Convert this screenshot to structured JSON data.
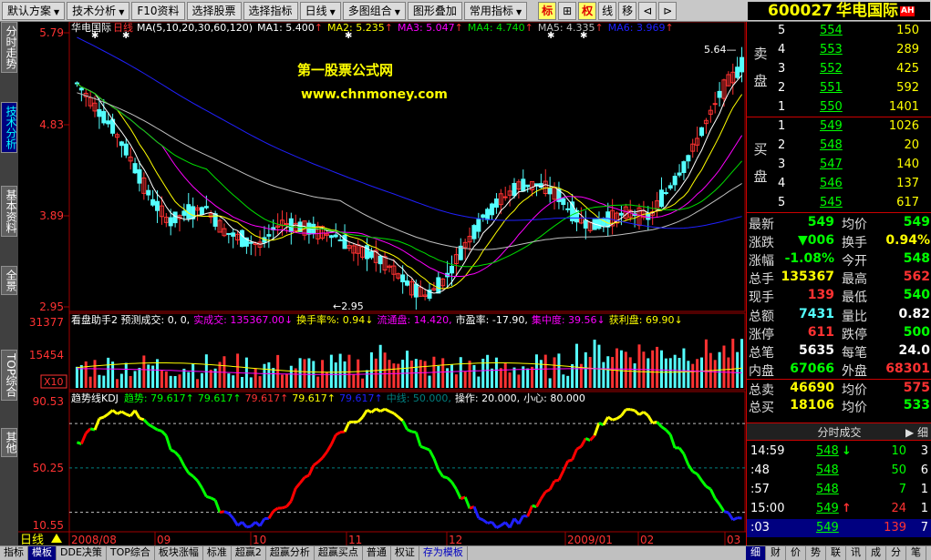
{
  "colors": {
    "up": "#ff3232",
    "down": "#54ffff",
    "ma1": "#ffffff",
    "ma2": "#ffff00",
    "ma3": "#ff00ff",
    "ma4": "#00e000",
    "ma5": "#c0c0c0",
    "ma6": "#2020ff",
    "bg": "#000000",
    "grid": "#8b0000"
  },
  "menu": [
    {
      "label": "默认方案",
      "dd": true
    },
    {
      "label": "技术分析",
      "dd": true
    },
    {
      "label": "F10资料",
      "dd": false
    },
    {
      "label": "选择股票",
      "dd": false
    },
    {
      "label": "选择指标",
      "dd": false
    },
    {
      "label": "日线",
      "dd": true
    },
    {
      "label": "多图组合",
      "dd": true
    },
    {
      "label": "图形叠加",
      "dd": false
    },
    {
      "label": "常用指标",
      "dd": true
    }
  ],
  "toolbar": [
    "标",
    "⊞",
    "权",
    "线",
    "移",
    "⊲",
    "⊳"
  ],
  "stock": {
    "code": "600027",
    "name": "华电国际",
    "badge": "AH"
  },
  "sidetabs": [
    "分时走势",
    "技术分析",
    "基本资料",
    "全景",
    "TOP综合",
    "其他"
  ],
  "main": {
    "name": "华电国际",
    "period": "日线",
    "ma_params": "MA(5,10,20,30,60,120)",
    "ma": [
      {
        "label": "MA1:",
        "value": "5.400",
        "arrow": "↑"
      },
      {
        "label": "MA2:",
        "value": "5.235",
        "arrow": "↑"
      },
      {
        "label": "MA3:",
        "value": "5.047",
        "arrow": "↑"
      },
      {
        "label": "MA4:",
        "value": "4.740",
        "arrow": "↑"
      },
      {
        "label": "MA5:",
        "value": "4.335",
        "arrow": "↑"
      },
      {
        "label": "MA6:",
        "value": "3.969",
        "arrow": "↑"
      }
    ],
    "y_ticks": [
      "5.79",
      "4.83",
      "3.89",
      "2.95"
    ],
    "high_label": "5.64",
    "low_label": "2.95",
    "watermark1": "第一股票公式网",
    "watermark2": "www.chnmoney.com"
  },
  "vol": {
    "name": "看盘助手2",
    "items": "预测成交: 0, 0,",
    "cj": "实成交: 135367.00↓",
    "hsl": "换手率%: 0.94↓",
    "ltp": "流通盘: 14.420,",
    "syl": "市盈率: -17.90,",
    "jzd": "集中度: 39.56↓",
    "hlp": "获利盘: 69.90↓",
    "y_ticks": [
      "31377",
      "15454"
    ],
    "unit": "X10"
  },
  "ind": {
    "name": "趋势线KDJ",
    "qs": "趋势: ",
    "v1": "79.617↑",
    "v2": "79.617↑",
    "v3": "79.617↑",
    "v4": "79.617↑",
    "v5": "79.617↑",
    "zx": "中线: 50.000,",
    "cz": "操作: 20.000,",
    "xx": "小心: 80.000",
    "y_ticks": [
      "90.53",
      "50.25",
      "10.55"
    ]
  },
  "xaxis": [
    "2008/08",
    "09",
    "10",
    "11",
    "12",
    "2009/01",
    "02",
    "03"
  ],
  "period_label": "日线",
  "chart_data": {
    "type": "candlestick",
    "title": "华电国际 日线",
    "ylim": [
      2.95,
      5.79
    ],
    "low": 2.95,
    "high": 5.64,
    "ma_last": {
      "MA1": 5.4,
      "MA2": 5.235,
      "MA3": 5.047,
      "MA4": 4.74,
      "MA5": 4.335,
      "MA6": 3.969
    },
    "close_trend": [
      5.3,
      5.05,
      4.8,
      4.45,
      4.05,
      3.8,
      3.9,
      3.95,
      3.7,
      3.6,
      3.55,
      3.8,
      3.75,
      3.7,
      3.65,
      3.5,
      3.45,
      3.3,
      3.1,
      3.0,
      3.2,
      3.55,
      3.85,
      4.05,
      4.2,
      4.2,
      4.1,
      3.85,
      3.75,
      3.85,
      3.9,
      3.85,
      4.15,
      4.45,
      4.85,
      5.25,
      5.49
    ],
    "indicator": {
      "name": "趋势线KDJ",
      "ylim": [
        10.55,
        90.53
      ],
      "lines": {
        "中线": 50,
        "操作": 20,
        "小心": 80
      },
      "last": 79.617
    }
  },
  "orderbook": {
    "sell_label": "卖\n盘",
    "buy_label": "买\n盘",
    "sell": [
      [
        "5",
        "554",
        "150"
      ],
      [
        "4",
        "553",
        "289"
      ],
      [
        "3",
        "552",
        "425"
      ],
      [
        "2",
        "551",
        "592"
      ],
      [
        "1",
        "550",
        "1401"
      ]
    ],
    "buy": [
      [
        "1",
        "549",
        "1026"
      ],
      [
        "2",
        "548",
        "20"
      ],
      [
        "3",
        "547",
        "140"
      ],
      [
        "4",
        "546",
        "137"
      ],
      [
        "5",
        "545",
        "617"
      ]
    ]
  },
  "quotes": [
    {
      "l1": "最新",
      "v1": "549",
      "l2": "均价",
      "v2": "549",
      "c1": "#00ff00",
      "c2": "#00ff00"
    },
    {
      "l1": "涨跌",
      "v1": "▼006",
      "l2": "换手",
      "v2": "0.94%",
      "c1": "#00ff00",
      "c2": "#ffff00"
    },
    {
      "l1": "涨幅",
      "v1": "-1.08%",
      "l2": "今开",
      "v2": "548",
      "c1": "#00ff00",
      "c2": "#00ff00"
    },
    {
      "l1": "总手",
      "v1": "135367",
      "l2": "最高",
      "v2": "562",
      "c1": "#ffff00",
      "c2": "#ff3232"
    },
    {
      "l1": "现手",
      "v1": "139",
      "l2": "最低",
      "v2": "540",
      "c1": "#ff3232",
      "c2": "#00ff00"
    },
    {
      "l1": "总额",
      "v1": "7431",
      "l2": "量比",
      "v2": "0.82",
      "c1": "#54ffff",
      "c2": "#ffffff"
    },
    {
      "l1": "涨停",
      "v1": "611",
      "l2": "跌停",
      "v2": "500",
      "c1": "#ff3232",
      "c2": "#00ff00"
    },
    {
      "l1": "总笔",
      "v1": "5635",
      "l2": "每笔",
      "v2": "24.0",
      "c1": "#ffffff",
      "c2": "#ffffff"
    },
    {
      "l1": "内盘",
      "v1": "67066",
      "l2": "外盘",
      "v2": "68301",
      "c1": "#00ff00",
      "c2": "#ff3232"
    },
    {
      "l1": "总卖",
      "v1": "46690",
      "l2": "均价",
      "v2": "575",
      "c1": "#ffff00",
      "c2": "#ff3232"
    },
    {
      "l1": "总买",
      "v1": "18106",
      "l2": "均价",
      "v2": "533",
      "c1": "#ffff00",
      "c2": "#00ff00"
    }
  ],
  "ticks_title": "分时成交",
  "ticks": [
    {
      "t": "14:59",
      "p": "548",
      "a": "↓",
      "v": "10",
      "n": "3",
      "pc": "#00ff00",
      "vc": "#00ff00"
    },
    {
      "t": ":48",
      "p": "548",
      "a": "",
      "v": "50",
      "n": "6",
      "pc": "#00ff00",
      "vc": "#00ff00"
    },
    {
      "t": ":57",
      "p": "548",
      "a": "",
      "v": "7",
      "n": "1",
      "pc": "#00ff00",
      "vc": "#00ff00"
    },
    {
      "t": "15:00",
      "p": "549",
      "a": "↑",
      "v": "24",
      "n": "1",
      "pc": "#00ff00",
      "vc": "#ff3232"
    },
    {
      "t": ":03",
      "p": "549",
      "a": "",
      "v": "139",
      "n": "7",
      "pc": "#00ff00",
      "vc": "#ff3232"
    }
  ],
  "status": [
    "指标",
    "模板",
    "DDE决策",
    "TOP综合",
    "板块涨幅",
    "标准",
    "超赢2",
    "超赢分析",
    "超赢买点",
    "普通",
    "权证",
    "存为模板"
  ],
  "right_tabs": [
    "细",
    "财",
    "价",
    "势",
    "联",
    "讯",
    "成",
    "分",
    "笔"
  ]
}
